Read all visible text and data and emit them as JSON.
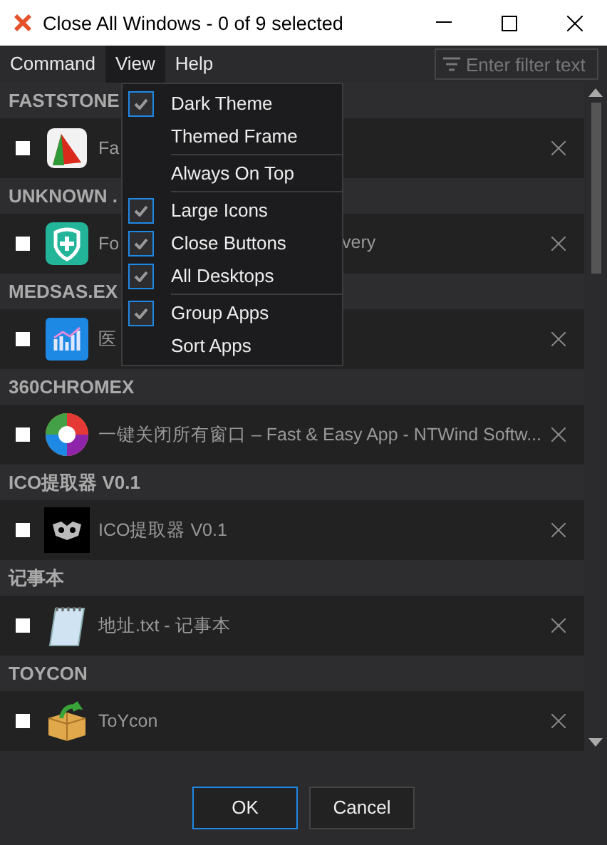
{
  "window": {
    "title": "Close All Windows - 0 of 9 selected"
  },
  "menubar": [
    {
      "label": "Command",
      "selected": false
    },
    {
      "label": "View",
      "selected": true
    },
    {
      "label": "Help",
      "selected": false
    }
  ],
  "filter": {
    "placeholder": "Enter filter text"
  },
  "groups": [
    {
      "name": "FASTSTONE",
      "items": [
        {
          "title": "Fa",
          "checked": false
        }
      ]
    },
    {
      "name": "UNKNOWN .",
      "items": [
        {
          "title": "Fo",
          "title_end": "very",
          "checked": false
        }
      ]
    },
    {
      "name": "MEDSAS.EX",
      "items": [
        {
          "title": "医",
          "checked": false
        }
      ]
    },
    {
      "name": "360CHROMEX",
      "items": [
        {
          "title": "一键关闭所有窗口 – Fast & Easy App - NTWind Softw...",
          "checked": false
        }
      ]
    },
    {
      "name": "ICO提取器 V0.1",
      "items": [
        {
          "title": "ICO提取器 V0.1",
          "checked": false
        }
      ]
    },
    {
      "name": "记事本",
      "items": [
        {
          "title": "地址.txt - 记事本",
          "checked": false
        }
      ]
    },
    {
      "name": "TOYCON",
      "items": [
        {
          "title": "ToYcon",
          "checked": false
        }
      ]
    }
  ],
  "view_menu": [
    {
      "kind": "item",
      "label": "Dark Theme",
      "checked": true
    },
    {
      "kind": "item",
      "label": "Themed Frame",
      "checked": false
    },
    {
      "kind": "separator"
    },
    {
      "kind": "item",
      "label": "Always On Top",
      "checked": false
    },
    {
      "kind": "separator"
    },
    {
      "kind": "item",
      "label": "Large Icons",
      "checked": true
    },
    {
      "kind": "item",
      "label": "Close Buttons",
      "checked": true
    },
    {
      "kind": "item",
      "label": "All Desktops",
      "checked": true
    },
    {
      "kind": "separator"
    },
    {
      "kind": "item",
      "label": "Group Apps",
      "checked": true
    },
    {
      "kind": "item",
      "label": "Sort Apps",
      "checked": false
    }
  ],
  "buttons": [
    {
      "label": "OK",
      "selected": true
    },
    {
      "label": "Cancel",
      "selected": false
    }
  ]
}
